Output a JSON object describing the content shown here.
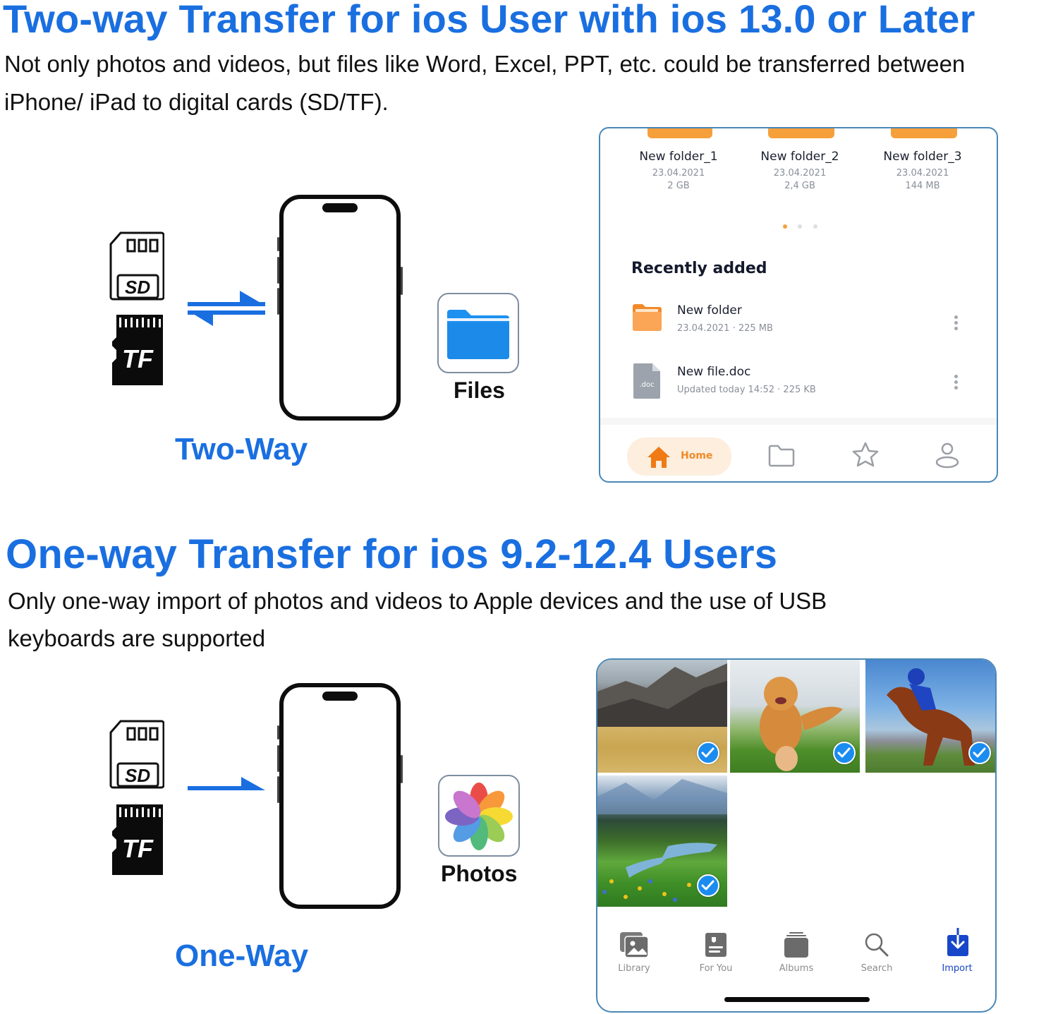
{
  "section_two_way": {
    "title": "Two-way Transfer for ios User with ios 13.0 or Later",
    "description_line1": "Not only photos and videos, but files like Word, Excel, PPT, etc. could be transferred between",
    "description_line2": "iPhone/ iPad to digital cards (SD/TF).",
    "mode_label": "Two-Way",
    "card_labels": {
      "sd": "SD",
      "tf": "TF"
    },
    "app": {
      "name": "Files",
      "icon": "folder-icon",
      "color": "#1e90f0"
    },
    "arrow": "bidirectional-arrow-icon",
    "files_app": {
      "folders": [
        {
          "name": "New folder_1",
          "date": "23.04.2021",
          "size": "2 GB"
        },
        {
          "name": "New folder_2",
          "date": "23.04.2021",
          "size": "2,4 GB"
        },
        {
          "name": "New folder_3",
          "date": "23.04.2021",
          "size": "144 MB"
        }
      ],
      "pager": {
        "pages": 3,
        "active": 1
      },
      "recent_heading": "Recently added",
      "recent_items": [
        {
          "name": "New folder",
          "meta": "23.04.2021  ·  225 MB",
          "icon": "folder-icon"
        },
        {
          "name": "New file.doc",
          "meta": "Updated today 14:52  ·  225 KB",
          "icon": "doc-file-icon",
          "icon_text": ".doc"
        }
      ],
      "nav": [
        {
          "label": "Home",
          "icon": "home-icon",
          "active": true
        },
        {
          "label": "",
          "icon": "folder-icon",
          "active": false
        },
        {
          "label": "",
          "icon": "star-icon",
          "active": false
        },
        {
          "label": "",
          "icon": "user-icon",
          "active": false
        }
      ],
      "accent_color": "#f5a03b"
    }
  },
  "section_one_way": {
    "title": "One-way Transfer for ios 9.2-12.4 Users",
    "description_line1": "Only one-way import of photos and videos to Apple devices and the use of USB",
    "description_line2": "keyboards are supported",
    "mode_label": "One-Way",
    "card_labels": {
      "sd": "SD",
      "tf": "TF"
    },
    "app": {
      "name": "Photos",
      "icon": "photos-flower-icon"
    },
    "arrow": "right-arrow-icon",
    "photos_app": {
      "photos": [
        {
          "subject": "mountain-grassland",
          "selected": true
        },
        {
          "subject": "golden-retriever",
          "selected": true
        },
        {
          "subject": "horse-racing-jockey",
          "selected": true
        },
        {
          "subject": "alpine-meadow-river",
          "selected": true
        }
      ],
      "tabs": [
        {
          "label": "Library",
          "icon": "library-icon",
          "active": false
        },
        {
          "label": "For You",
          "icon": "for-you-icon",
          "active": false
        },
        {
          "label": "Albums",
          "icon": "albums-icon",
          "active": false
        },
        {
          "label": "Search",
          "icon": "search-icon",
          "active": false
        },
        {
          "label": "Import",
          "icon": "import-icon",
          "active": true
        }
      ],
      "accent_color": "#1747c8"
    }
  },
  "colors": {
    "heading_blue": "#1a6fe0",
    "arrow_blue": "#1a6fe0",
    "check_blue": "#1a8cf0"
  }
}
